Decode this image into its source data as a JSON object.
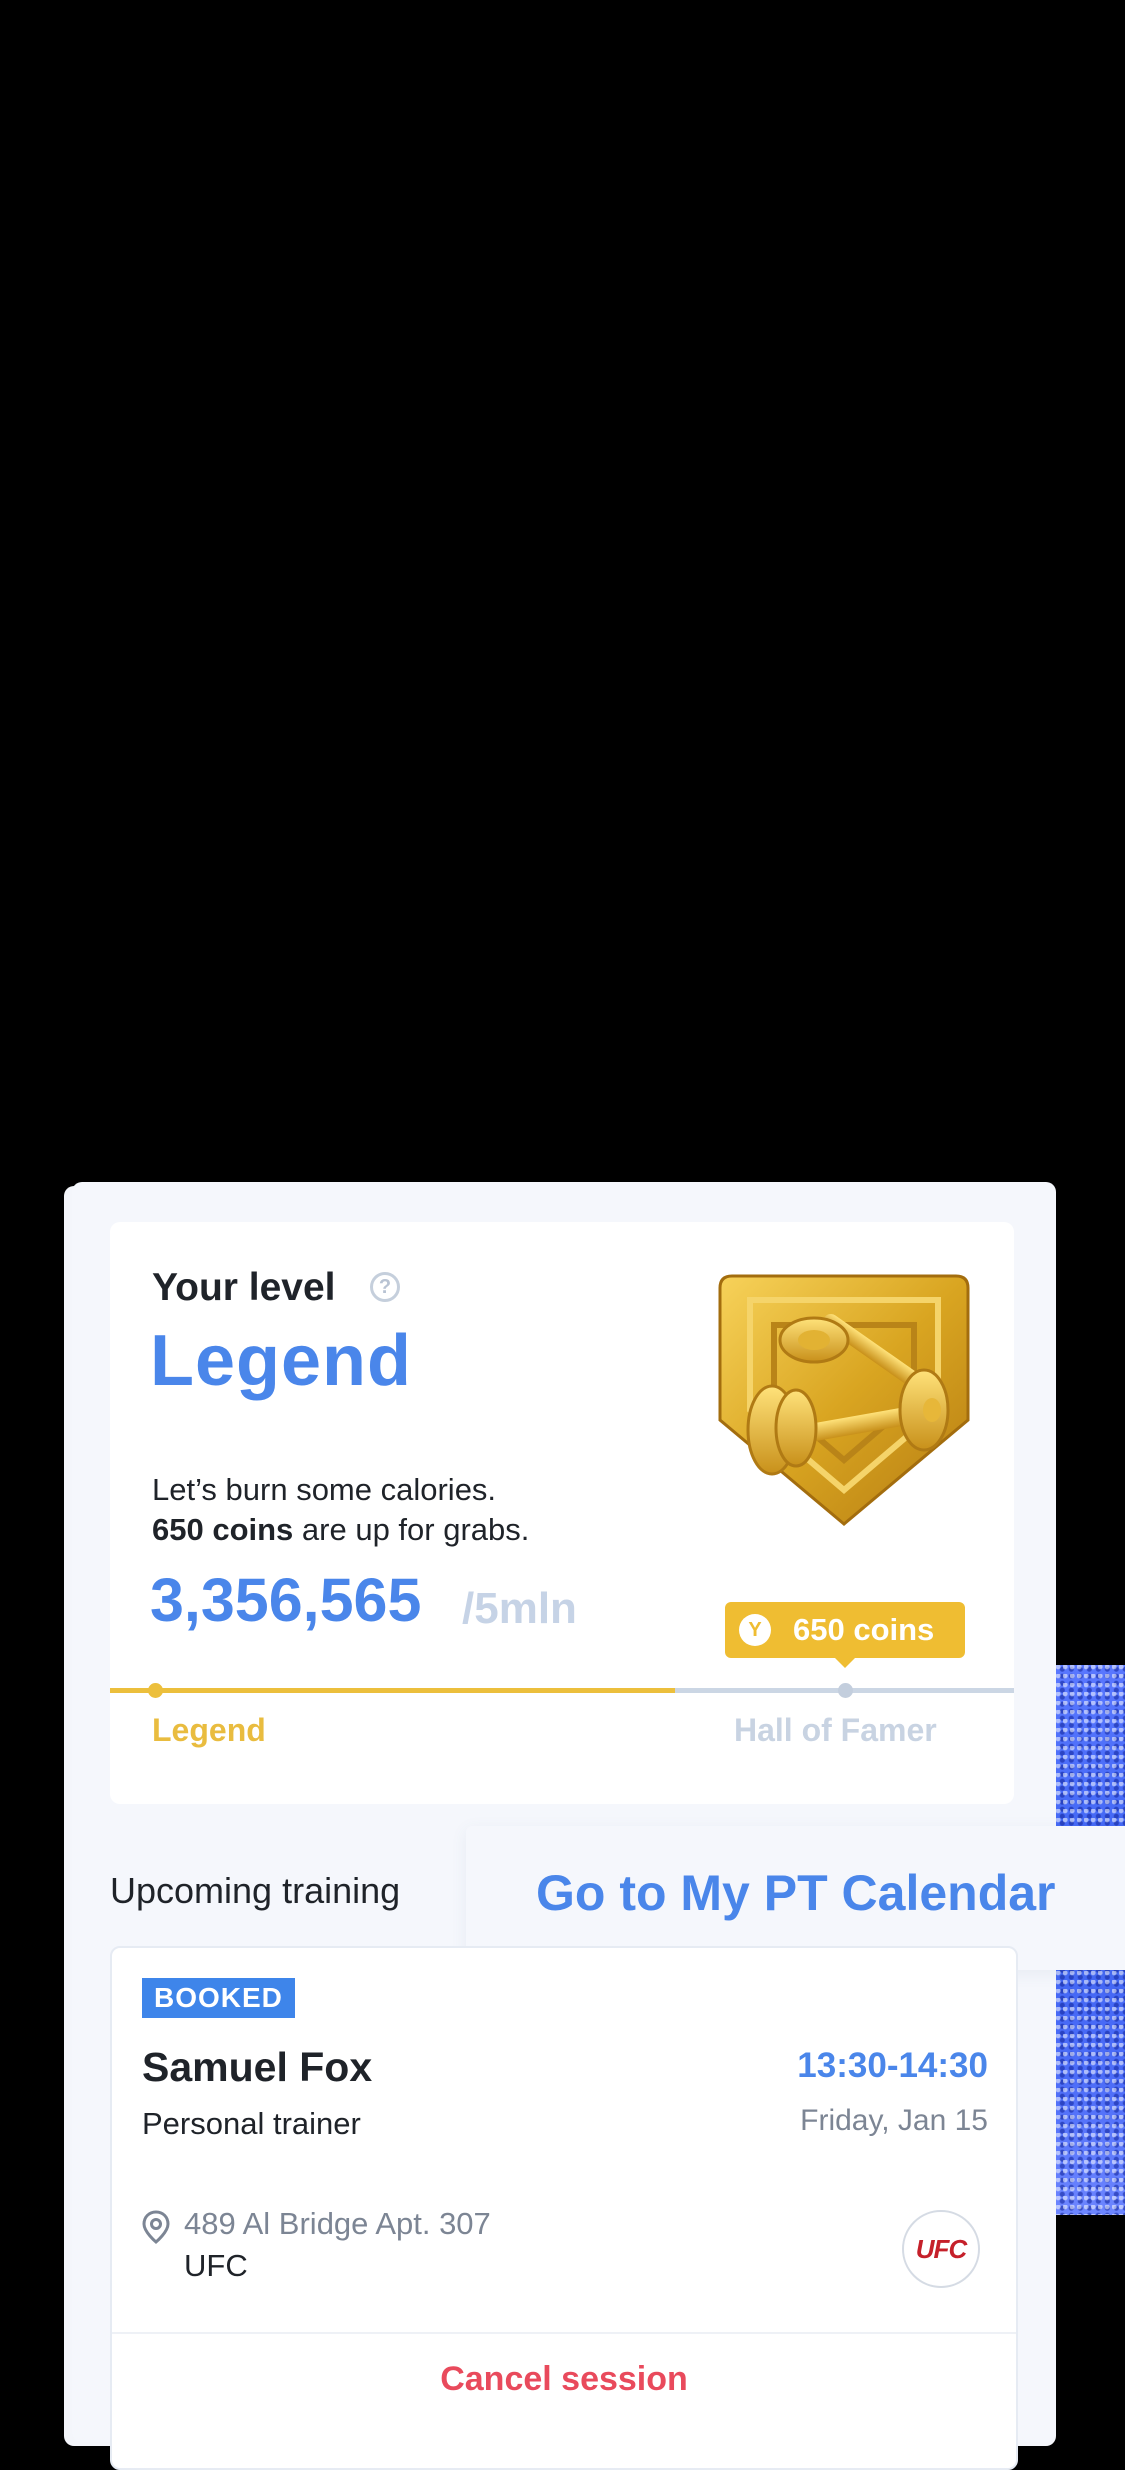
{
  "level": {
    "title": "Your level",
    "help_icon": "question-circle-icon",
    "name": "Legend",
    "message_line1": "Let’s burn some calories.",
    "coins_bold": "650 coins",
    "message_line2_rest": " are up for grabs.",
    "points": "3,356,565",
    "points_max": "/5mln",
    "progress_fraction": 0.67,
    "next_reward": "650 coins",
    "current_level": "Legend",
    "next_level": "Hall of Famer",
    "badge_icon": "golden-dumbbells-badge-icon",
    "colors": {
      "accent": "#4a86ea",
      "gold": "#ecbf3c",
      "muted": "#c8d3e2"
    }
  },
  "upcoming": {
    "heading": "Upcoming training",
    "calendar_link": "Go to My PT Calendar"
  },
  "session": {
    "status": "BOOKED",
    "trainer_name": "Samuel Fox",
    "trainer_role": "Personal trainer",
    "time": "13:30-14:30",
    "date": "Friday, Jan 15",
    "address": "489 Al Bridge Apt. 307",
    "venue": "UFC",
    "venue_logo_text": "UFC",
    "cancel_label": "Cancel session",
    "colors": {
      "cancel": "#e94a5c"
    }
  }
}
